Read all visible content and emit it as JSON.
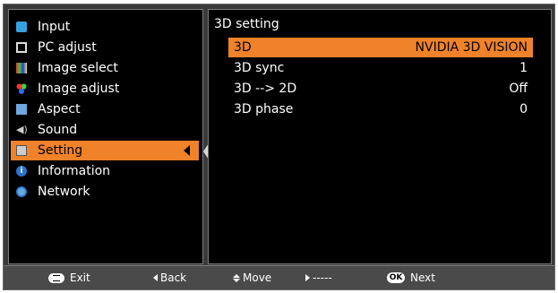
{
  "left_menu": {
    "items": [
      {
        "label": "Input",
        "icon": "input-icon"
      },
      {
        "label": "PC adjust",
        "icon": "pc-adjust-icon"
      },
      {
        "label": "Image select",
        "icon": "image-select-icon"
      },
      {
        "label": "Image adjust",
        "icon": "image-adjust-icon"
      },
      {
        "label": "Aspect",
        "icon": "aspect-icon"
      },
      {
        "label": "Sound",
        "icon": "sound-icon"
      },
      {
        "label": "Setting",
        "icon": "setting-icon"
      },
      {
        "label": "Information",
        "icon": "information-icon"
      },
      {
        "label": "Network",
        "icon": "network-icon"
      }
    ],
    "active": "Setting"
  },
  "right_panel": {
    "title": "3D setting",
    "rows": [
      {
        "label": "3D",
        "value": "NVIDIA 3D VISION"
      },
      {
        "label": "3D sync",
        "value": "1"
      },
      {
        "label": "3D --> 2D",
        "value": "Off"
      },
      {
        "label": "3D phase",
        "value": "0"
      }
    ]
  },
  "footer": {
    "exit": "Exit",
    "back": "Back",
    "move": "Move",
    "dash": "-----",
    "ok_key": "OK",
    "next": "Next"
  },
  "colors": {
    "highlight": "#f0822a",
    "panel_bg": "#000000",
    "frame_bg": "#3a3a3a"
  }
}
